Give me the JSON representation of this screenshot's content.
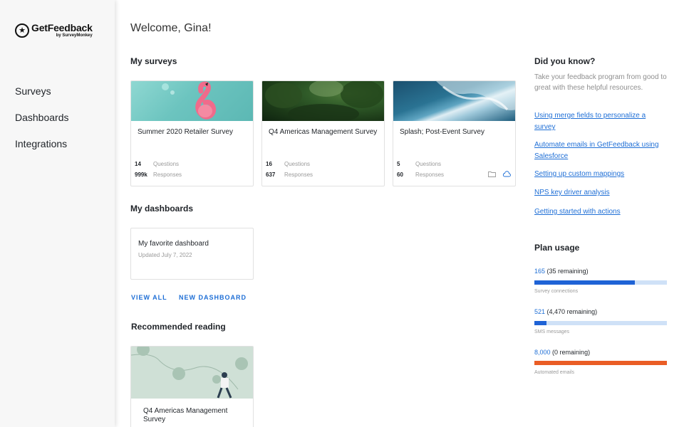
{
  "brand": {
    "name": "GetFeedback",
    "sub": "by SurveyMonkey",
    "mark": "★"
  },
  "nav": {
    "items": [
      "Surveys",
      "Dashboards",
      "Integrations"
    ]
  },
  "welcome": "Welcome, Gina!",
  "surveys": {
    "title": "My surveys",
    "cards": [
      {
        "title": "Summer 2020 Retailer Survey",
        "questions": "14",
        "responses": "999k",
        "questions_label": "Questions",
        "responses_label": "Responses",
        "image": "flamingo"
      },
      {
        "title": "Q4 Americas Management Survey",
        "questions": "16",
        "responses": "637",
        "questions_label": "Questions",
        "responses_label": "Responses",
        "image": "forest"
      },
      {
        "title": "Splash; Post-Event Survey",
        "questions": "5",
        "responses": "60",
        "questions_label": "Questions",
        "responses_label": "Responses",
        "image": "waves",
        "icons": [
          "folder-icon",
          "cloud-icon"
        ]
      }
    ]
  },
  "dashboards": {
    "title": "My dashboards",
    "card": {
      "title": "My favorite dashboard",
      "updated": "Updated July 7, 2022"
    },
    "view_all": "VIEW ALL",
    "new_dashboard": "NEW DASHBOARD"
  },
  "reading": {
    "title": "Recommended reading",
    "card": {
      "title": "Q4 Americas Management Survey"
    }
  },
  "tips": {
    "title": "Did you know?",
    "text": "Take your feedback program from good to great with these helpful resources.",
    "links": [
      "Using merge fields to personalize a survey",
      "Automate emails in GetFeedback using Salesforce",
      "Setting up custom mappings",
      "NPS key driver analysis",
      "Getting started with actions"
    ]
  },
  "plan": {
    "title": "Plan usage",
    "items": [
      {
        "used": "165",
        "remaining": "(35 remaining)",
        "label": "Survey connections",
        "fraction": 0.76,
        "color": "#1f63d6"
      },
      {
        "used": "521",
        "remaining": "(4,470 remaining)",
        "label": "SMS messages",
        "fraction": 0.09,
        "color": "#1f63d6"
      },
      {
        "used": "8,000",
        "remaining": "(0 remaining)",
        "label": "Automated emails",
        "fraction": 1.0,
        "color": "#ea5d25"
      }
    ]
  },
  "colors": {
    "accent": "#1f6fd6",
    "bar_track": "#cfe1f7",
    "bar_full": "#ea5d25"
  }
}
